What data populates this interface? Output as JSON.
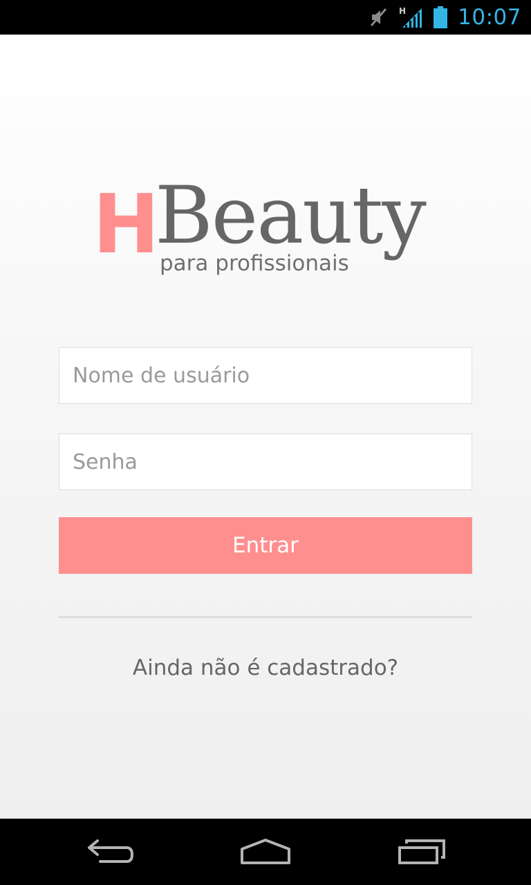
{
  "status_bar": {
    "time": "10:07",
    "network_label": "H",
    "icons": [
      "muted-icon",
      "signal-icon",
      "battery-icon"
    ],
    "accent_color": "#33b5e5"
  },
  "logo": {
    "h": "H",
    "word": "Beauty",
    "tagline": "para profissionais"
  },
  "login_form": {
    "username_placeholder": "Nome de usuário",
    "username_value": "",
    "password_placeholder": "Senha",
    "password_value": "",
    "submit_label": "Entrar"
  },
  "signup_prompt": "Ainda não é cadastrado?",
  "nav_bar": {
    "icons": [
      "back-icon",
      "home-icon",
      "recents-icon"
    ]
  },
  "colors": {
    "brand": "#ff8f8f",
    "text_gray": "#666666"
  }
}
